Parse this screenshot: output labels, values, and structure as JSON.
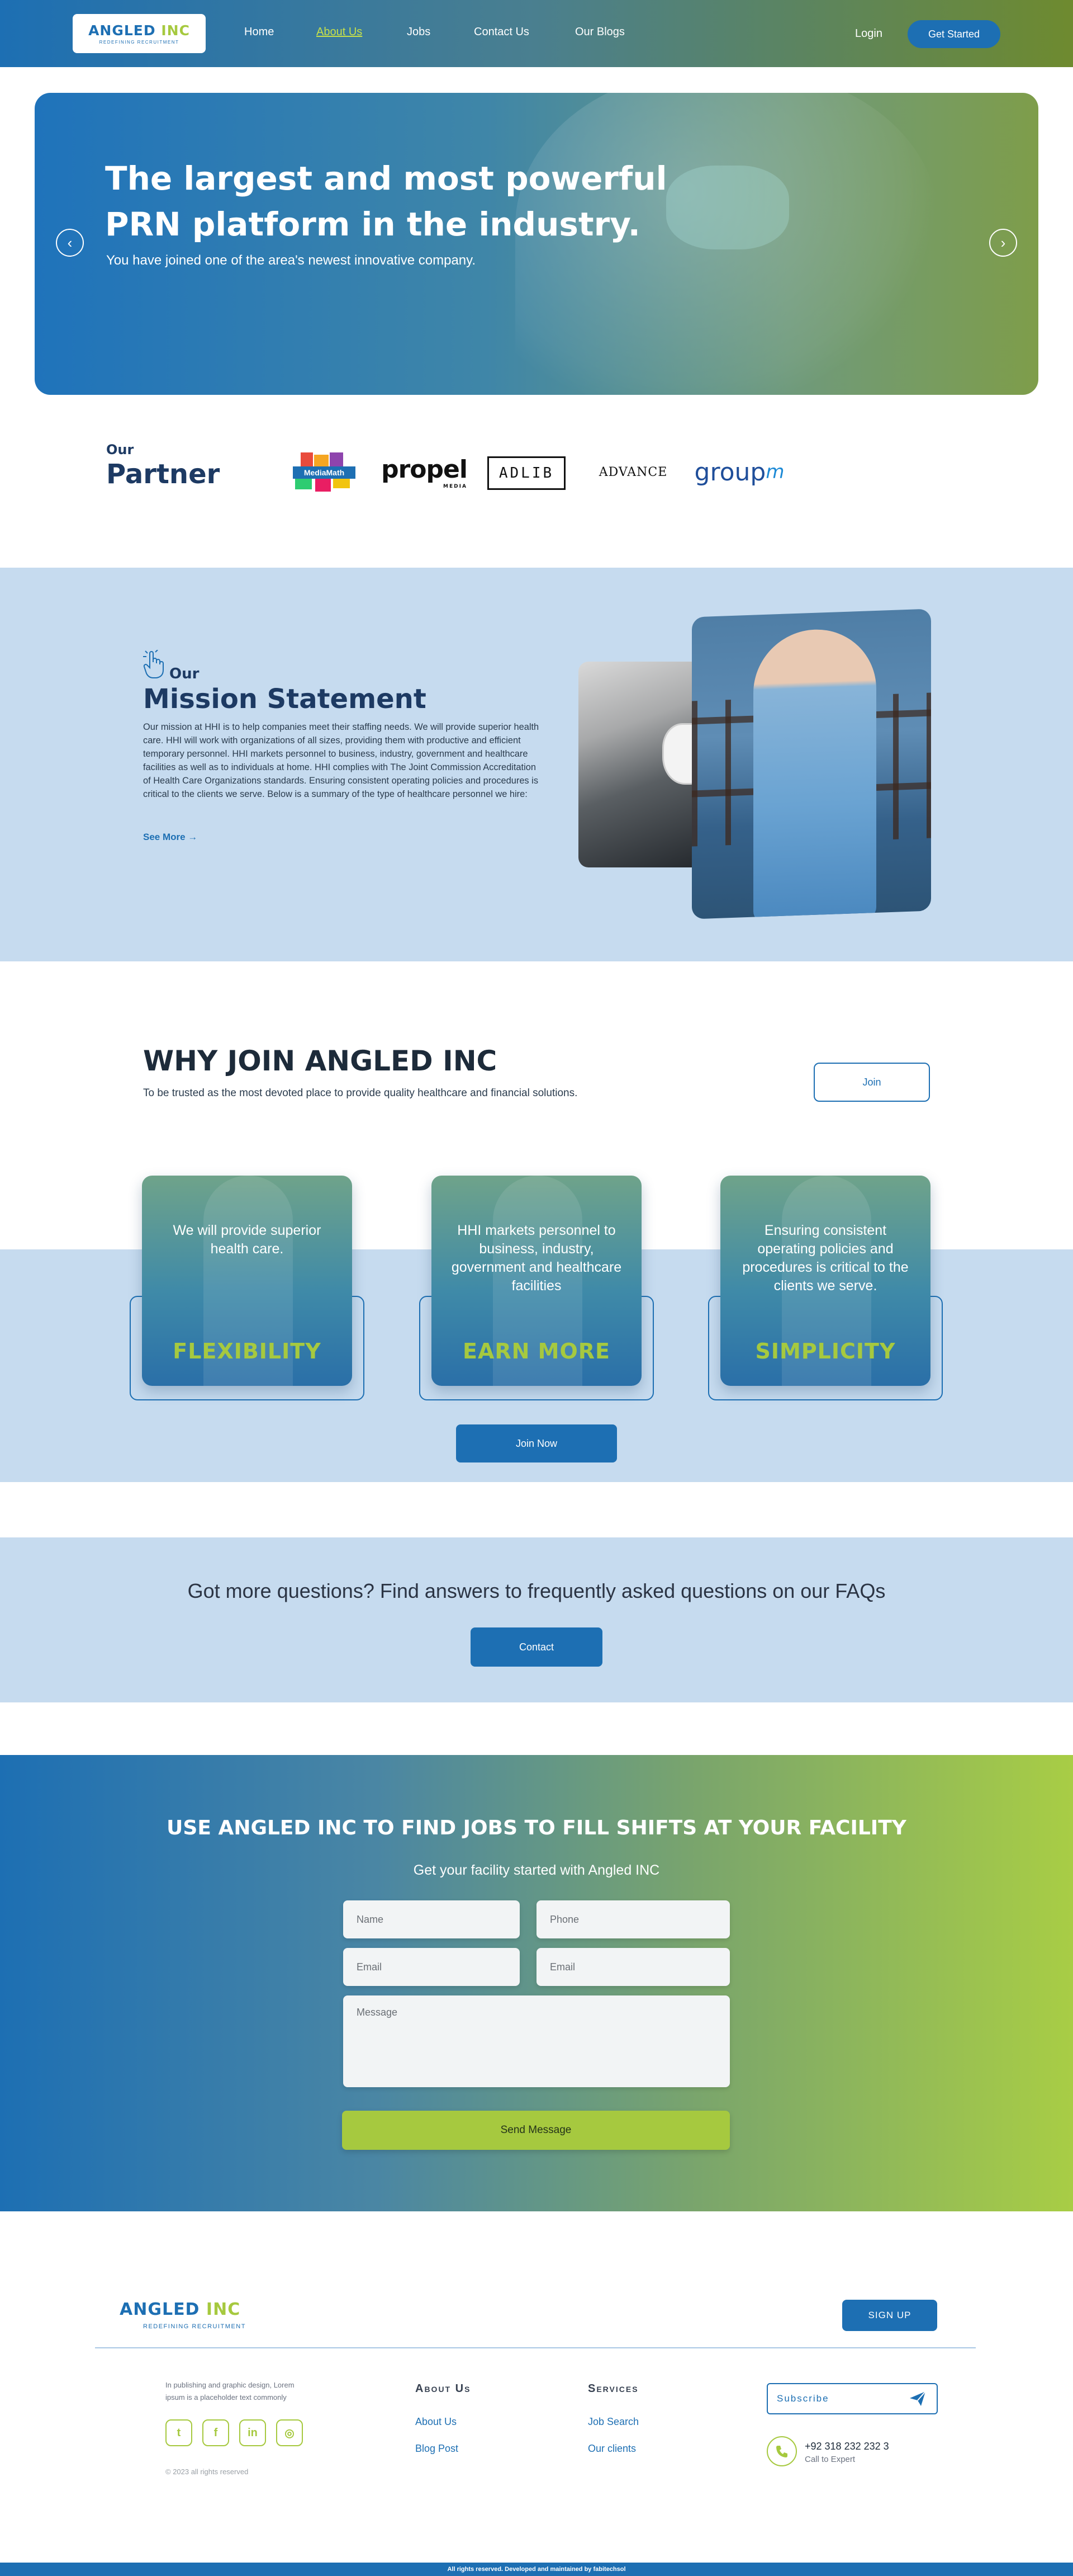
{
  "header": {
    "logo": {
      "main": "ANGLED",
      "accent": "INC",
      "tagline": "REDEFINING RECRUITMENT"
    },
    "nav": [
      {
        "label": "Home",
        "active": false
      },
      {
        "label": "About Us",
        "active": true
      },
      {
        "label": "Jobs",
        "active": false
      },
      {
        "label": "Contact Us",
        "active": false
      },
      {
        "label": "Our Blogs",
        "active": false
      }
    ],
    "login": "Login",
    "get_started": "Get Started"
  },
  "hero": {
    "title": "The largest and most powerful PRN platform in the industry.",
    "subtitle": "You have joined one of the area's newest innovative company.",
    "prev_icon": "chevron-left-icon",
    "next_icon": "chevron-right-icon"
  },
  "partners": {
    "label_our": "Our",
    "label_title": "Partner",
    "logos": [
      "MediaMath",
      "propel",
      "MEDIA",
      "ADLIB",
      "ADVANCE",
      "group",
      "m"
    ]
  },
  "mission": {
    "our": "Our",
    "title": "Mission Statement",
    "text": "Our mission at HHI is to help companies meet their staffing needs. We will provide superior health care. HHI will work with organizations of all sizes, providing them with productive and efficient temporary personnel. HHI markets personnel to business, industry, government and healthcare facilities as well as to individuals at home. HHI complies with The Joint Commission Accreditation of Health Care Organizations standards. Ensuring consistent operating policies and procedures is critical to the clients we serve. Below is a summary of the type of healthcare personnel we hire:",
    "see_more": "See More →"
  },
  "why": {
    "title": "WHY JOIN ANGLED INC",
    "subtitle": "To be trusted as the most devoted place to provide quality healthcare and financial solutions.",
    "join": "Join",
    "cards": [
      {
        "text": "We will provide superior health care.",
        "label": "FLEXIBILITY"
      },
      {
        "text": "HHI markets personnel to business, industry, government and healthcare facilities",
        "label": "EARN MORE"
      },
      {
        "text": "Ensuring consistent operating policies and procedures is critical to the clients we serve.",
        "label": "SIMPLICITY"
      }
    ],
    "join_now": "Join Now"
  },
  "faq": {
    "text": "Got more questions? Find answers to frequently asked questions on our FAQs",
    "contact": "Contact"
  },
  "cta": {
    "title": "USE ANGLED INC TO FIND JOBS TO FILL SHIFTS AT YOUR FACILITY",
    "subtitle": "Get your facility started with Angled INC",
    "placeholders": {
      "name": "Name",
      "phone": "Phone",
      "email1": "Email",
      "email2": "Email",
      "message": "Message"
    },
    "send": "Send Message"
  },
  "footer": {
    "logo": {
      "main": "ANGLED",
      "accent": "INC",
      "tagline": "REDEFINING RECRUITMENT"
    },
    "signup": "SIGN UP",
    "about": "In publishing and graphic design, Lorem ipsum is a placeholder text commonly",
    "social": [
      {
        "icon": "twitter-icon",
        "glyph": "t"
      },
      {
        "icon": "facebook-icon",
        "glyph": "f"
      },
      {
        "icon": "linkedin-icon",
        "glyph": "in"
      },
      {
        "icon": "instagram-icon",
        "glyph": "◎"
      }
    ],
    "copyright": "© 2023 all rights reserved",
    "about_col": {
      "heading": "About Us",
      "links": [
        "About Us",
        "Blog Post"
      ]
    },
    "services_col": {
      "heading": "Services",
      "links": [
        "Job Search",
        "Our clients"
      ]
    },
    "subscribe_placeholder": "Subscribe",
    "phone": {
      "number": "+92 318 232 232 3",
      "label": "Call to Expert"
    },
    "bottom": "All rights reserved. Developed and maintained by fabitechsol"
  },
  "colors": {
    "primary": "#1d6fb3",
    "accent": "#a6c93f",
    "light_band": "#c6dbef",
    "dark_text": "#1d3a63"
  }
}
